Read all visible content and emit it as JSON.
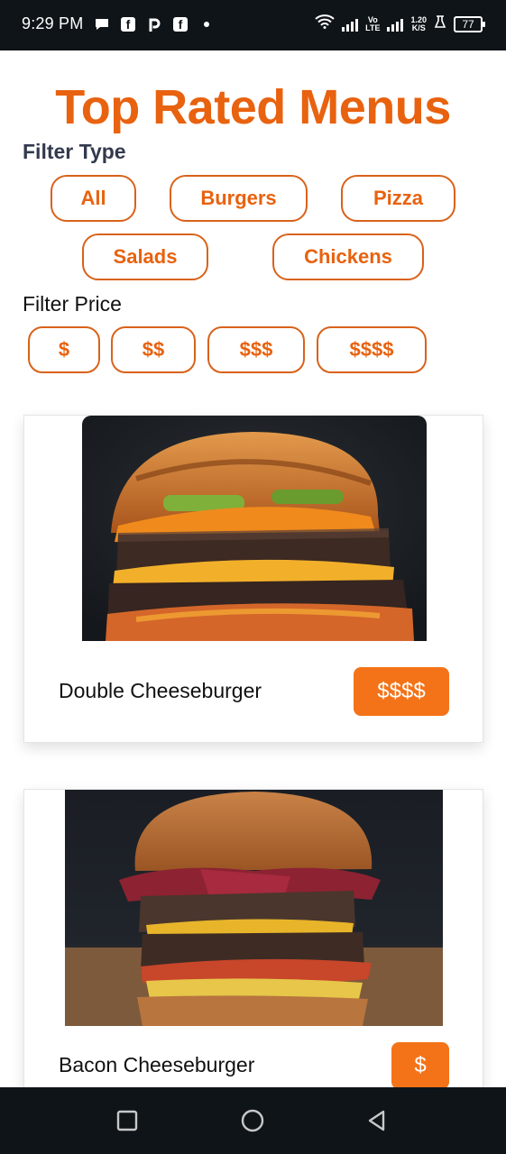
{
  "status_bar": {
    "time": "9:29 PM",
    "net_speed_value": "1.20",
    "net_speed_unit": "K/S",
    "vo_label": "Vo",
    "lte_label": "LTE",
    "battery": "77"
  },
  "page": {
    "title": "Top Rated Menus"
  },
  "filter_type": {
    "label": "Filter Type",
    "options": [
      "All",
      "Burgers",
      "Pizza",
      "Salads",
      "Chickens"
    ]
  },
  "filter_price": {
    "label": "Filter Price",
    "options": [
      "$",
      "$$",
      "$$$",
      "$$$$"
    ]
  },
  "menu_items": [
    {
      "name": "Double Cheeseburger",
      "price": "$$$$"
    },
    {
      "name": "Bacon Cheeseburger",
      "price": "$"
    }
  ],
  "colors": {
    "accent": "#e8620f",
    "badge": "#f47318",
    "system_bar": "#0f1419"
  }
}
